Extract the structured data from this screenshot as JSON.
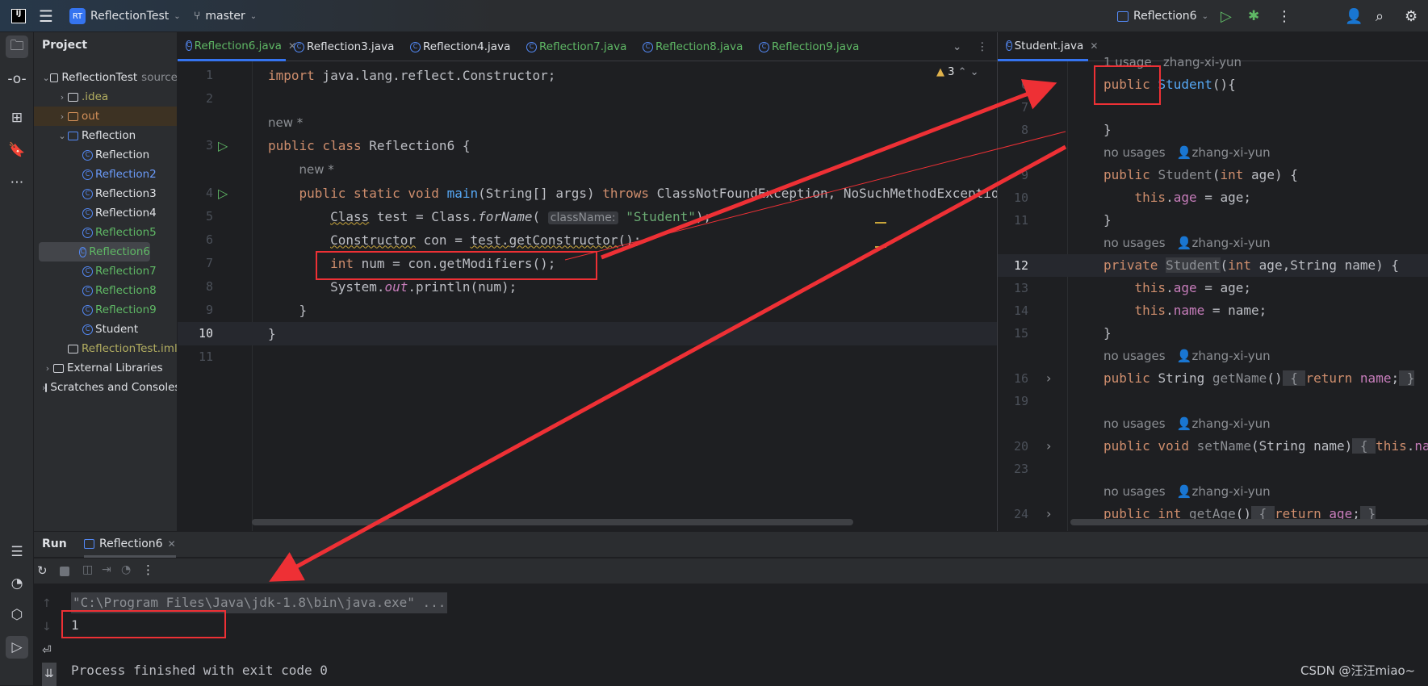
{
  "topbar": {
    "project_badge": "RT",
    "project": "ReflectionTest",
    "branch": "master",
    "run_config": "Reflection6"
  },
  "project_panel": {
    "title": "Project",
    "items": [
      {
        "label": "ReflectionTest",
        "suffix": "source",
        "depth": 0,
        "arrow": "v",
        "icon": "folder",
        "color": "default"
      },
      {
        "label": ".idea",
        "depth": 1,
        "arrow": ">",
        "icon": "folder",
        "color": "olive"
      },
      {
        "label": "out",
        "depth": 1,
        "arrow": ">",
        "icon": "folder",
        "color": "orange"
      },
      {
        "label": "Reflection",
        "depth": 1,
        "arrow": "v",
        "icon": "folder",
        "color": "default"
      },
      {
        "label": "Reflection",
        "depth": 2,
        "icon": "class",
        "color": "default"
      },
      {
        "label": "Reflection2",
        "depth": 2,
        "icon": "class",
        "color": "blue2"
      },
      {
        "label": "Reflection3",
        "depth": 2,
        "icon": "class",
        "color": "default"
      },
      {
        "label": "Reflection4",
        "depth": 2,
        "icon": "class",
        "color": "default"
      },
      {
        "label": "Reflection5",
        "depth": 2,
        "icon": "class",
        "color": "green"
      },
      {
        "label": "Reflection6",
        "depth": 2,
        "icon": "class",
        "color": "green"
      },
      {
        "label": "Reflection7",
        "depth": 2,
        "icon": "class",
        "color": "green"
      },
      {
        "label": "Reflection8",
        "depth": 2,
        "icon": "class",
        "color": "green"
      },
      {
        "label": "Reflection9",
        "depth": 2,
        "icon": "class",
        "color": "green"
      },
      {
        "label": "Student",
        "depth": 2,
        "icon": "class",
        "color": "default"
      },
      {
        "label": "ReflectionTest.iml",
        "depth": 1,
        "icon": "file",
        "color": "olive"
      },
      {
        "label": "External Libraries",
        "depth": 0,
        "arrow": ">",
        "icon": "library",
        "color": "default"
      },
      {
        "label": "Scratches and Consoles",
        "depth": 0,
        "arrow": ">",
        "icon": "scratch",
        "color": "default"
      }
    ]
  },
  "editor_left": {
    "tabs": [
      {
        "label": "Reflection6.java",
        "color": "green",
        "active": true
      },
      {
        "label": "Reflection3.java",
        "color": "default"
      },
      {
        "label": "Reflection4.java",
        "color": "default"
      },
      {
        "label": "Reflection7.java",
        "color": "green"
      },
      {
        "label": "Reflection8.java",
        "color": "green"
      },
      {
        "label": "Reflection9.java",
        "color": "green"
      }
    ],
    "warnings": "3",
    "lines": [
      {
        "n": "1",
        "t": [
          [
            "import",
            "kw"
          ],
          " java.lang.reflect.Constructor;"
        ]
      },
      {
        "n": "2",
        "t": []
      },
      {
        "n": "",
        "t": [
          [
            "new *",
            "meta"
          ]
        ]
      },
      {
        "n": "3",
        "run": true,
        "t": [
          [
            "public class ",
            "kw"
          ],
          "Reflection6 {"
        ]
      },
      {
        "n": "",
        "t": [
          "    ",
          [
            "new *",
            "meta"
          ]
        ]
      },
      {
        "n": "4",
        "run": true,
        "t": [
          "    ",
          [
            "public static void ",
            "kw"
          ],
          [
            "main",
            "fn"
          ],
          "(String[] args) ",
          [
            "throws ",
            "kw"
          ],
          "ClassNotFoundException, NoSuchMethodException {"
        ]
      },
      {
        "n": "5",
        "t": [
          "        ",
          [
            "Class",
            "squig"
          ],
          " test = Class.",
          [
            "forName",
            "it"
          ],
          "( ",
          [
            "className:",
            "hint"
          ],
          " ",
          [
            "\"Student\"",
            "str"
          ],
          ");"
        ]
      },
      {
        "n": "6",
        "t": [
          "        ",
          [
            "Constructor",
            "squig"
          ],
          " con = ",
          [
            "test.getConstructor",
            "squig"
          ],
          "();"
        ]
      },
      {
        "n": "7",
        "t": [
          "        ",
          [
            "int ",
            "kw"
          ],
          "num = con.getModifiers();"
        ]
      },
      {
        "n": "8",
        "t": [
          "        System.",
          [
            "out",
            "itf"
          ],
          ".println(num);"
        ]
      },
      {
        "n": "9",
        "t": [
          "    }"
        ]
      },
      {
        "n": "10",
        "cur": true,
        "t": [
          "}"
        ]
      },
      {
        "n": "11",
        "t": []
      }
    ]
  },
  "editor_right": {
    "tab": "Student.java",
    "lines": [
      {
        "n": "",
        "t": [
          [
            "1 usage   zhang-xi-yun",
            "meta"
          ]
        ]
      },
      {
        "n": "6",
        "t": [
          [
            "public ",
            "kw"
          ],
          [
            "Student",
            "fn"
          ],
          "(){"
        ]
      },
      {
        "n": "7",
        "t": []
      },
      {
        "n": "8",
        "t": [
          "}"
        ]
      },
      {
        "n": "",
        "t": [
          [
            "no usages   👤zhang-xi-yun",
            "meta"
          ]
        ]
      },
      {
        "n": "9",
        "t": [
          [
            "public ",
            "kw"
          ],
          [
            "Student",
            "dim"
          ],
          "(",
          [
            "int ",
            "kw"
          ],
          "age) {"
        ]
      },
      {
        "n": "10",
        "t": [
          "    ",
          [
            "this",
            "kw"
          ],
          ".",
          [
            "age",
            "fld"
          ],
          " = age;"
        ]
      },
      {
        "n": "11",
        "t": [
          "}"
        ]
      },
      {
        "n": "",
        "t": [
          [
            "no usages   👤zhang-xi-yun",
            "meta"
          ]
        ]
      },
      {
        "n": "12",
        "cur": true,
        "t": [
          [
            "private ",
            "kw"
          ],
          [
            "Student",
            "fold"
          ],
          "(",
          [
            "int ",
            "kw"
          ],
          "age,String name) {"
        ]
      },
      {
        "n": "13",
        "t": [
          "    ",
          [
            "this",
            "kw"
          ],
          ".",
          [
            "age",
            "fld"
          ],
          " = age;"
        ]
      },
      {
        "n": "14",
        "t": [
          "    ",
          [
            "this",
            "kw"
          ],
          ".",
          [
            "name",
            "fld"
          ],
          " = name;"
        ]
      },
      {
        "n": "15",
        "t": [
          "}"
        ]
      },
      {
        "n": "",
        "t": [
          [
            "no usages   👤zhang-xi-yun",
            "meta"
          ]
        ]
      },
      {
        "n": "16",
        "fold": true,
        "t": [
          [
            "public ",
            "kw"
          ],
          "String ",
          [
            "getName",
            "dim"
          ],
          "()",
          [
            " { ",
            "fold"
          ],
          [
            "return ",
            "kw"
          ],
          [
            "name",
            "fld"
          ],
          ";",
          [
            " }",
            "fold"
          ]
        ]
      },
      {
        "n": "19",
        "t": []
      },
      {
        "n": "",
        "t": [
          [
            "no usages   👤zhang-xi-yun",
            "meta"
          ]
        ]
      },
      {
        "n": "20",
        "fold": true,
        "t": [
          [
            "public void ",
            "kw"
          ],
          [
            "setName",
            "dim"
          ],
          "(String name)",
          [
            " { ",
            "fold"
          ],
          [
            "this",
            "kw"
          ],
          ".",
          [
            "name",
            "fld"
          ],
          " = name; }"
        ]
      },
      {
        "n": "23",
        "t": []
      },
      {
        "n": "",
        "t": [
          [
            "no usages   👤zhang-xi-yun",
            "meta"
          ]
        ]
      },
      {
        "n": "24",
        "fold": true,
        "t": [
          [
            "public int ",
            "kw"
          ],
          [
            "getAge",
            "dim"
          ],
          "()",
          [
            " { ",
            "fold"
          ],
          [
            "return ",
            "kw"
          ],
          [
            "age",
            "fld"
          ],
          ";",
          [
            " }",
            "fold"
          ]
        ]
      }
    ]
  },
  "run_panel": {
    "title": "Run",
    "tab": "Reflection6",
    "console": [
      "\"C:\\Program Files\\Java\\jdk-1.8\\bin\\java.exe\" ...",
      "1",
      "",
      "Process finished with exit code 0"
    ]
  },
  "watermark": "CSDN @汪汪miao~",
  "colors": {
    "annotation": "#ee3035",
    "accent": "#3574f0",
    "keyword": "#cf8e6d",
    "string": "#6aab73"
  }
}
